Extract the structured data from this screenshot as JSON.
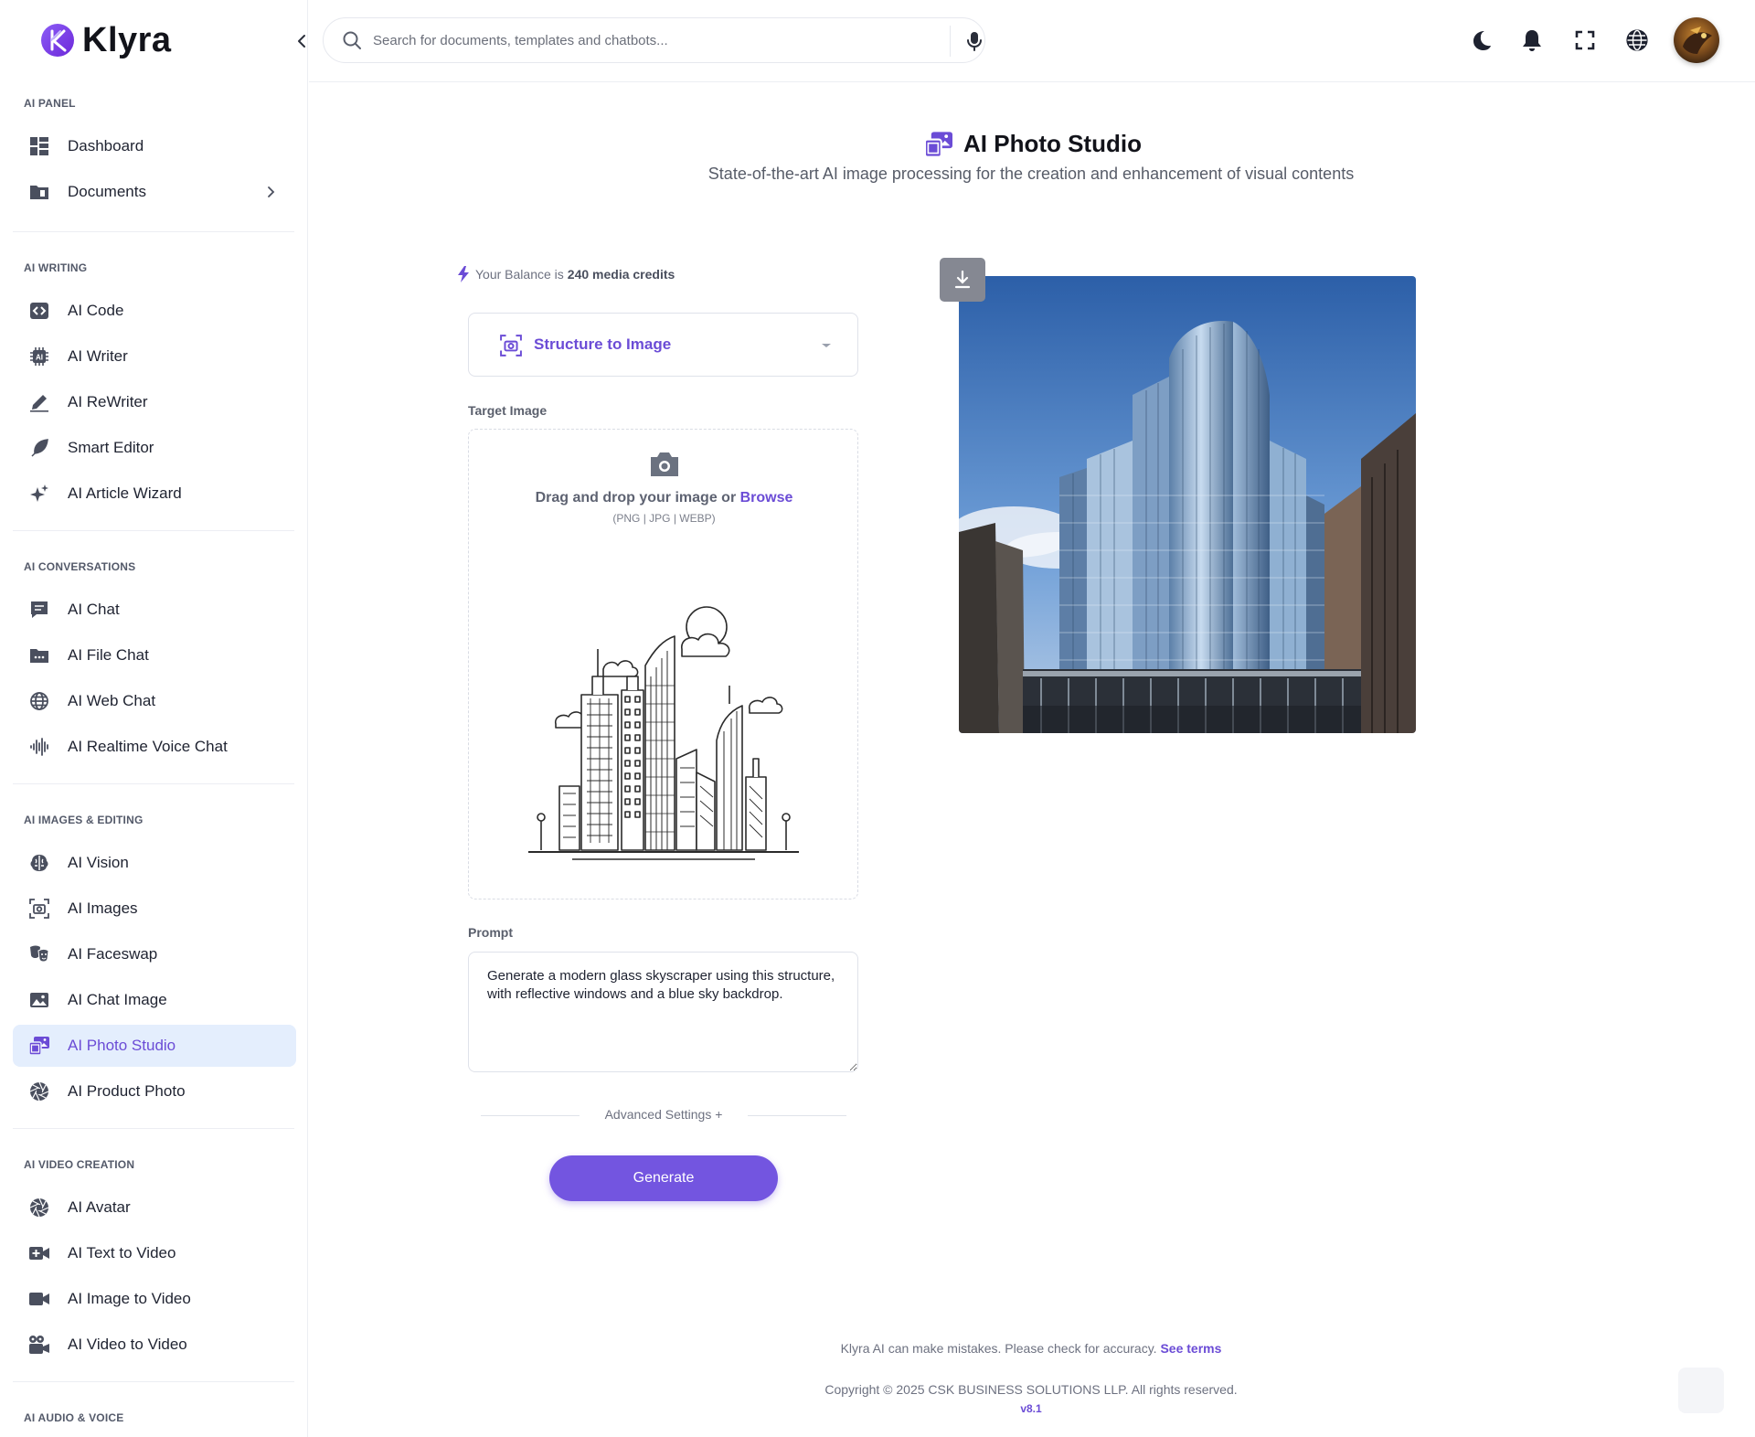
{
  "brand": {
    "name": "Klyra"
  },
  "search": {
    "placeholder": "Search for documents, templates and chatbots..."
  },
  "sidebar": {
    "sections": [
      {
        "title": "AI PANEL",
        "items": [
          {
            "label": "Dashboard",
            "icon": "dashboard-icon"
          },
          {
            "label": "Documents",
            "icon": "folder-icon",
            "has_submenu": true
          }
        ]
      },
      {
        "title": "AI WRITING",
        "items": [
          {
            "label": "AI Code",
            "icon": "code-icon"
          },
          {
            "label": "AI Writer",
            "icon": "chip-icon"
          },
          {
            "label": "AI ReWriter",
            "icon": "pen-icon"
          },
          {
            "label": "Smart Editor",
            "icon": "feather-icon"
          },
          {
            "label": "AI Article Wizard",
            "icon": "sparkles-icon"
          }
        ]
      },
      {
        "title": "AI CONVERSATIONS",
        "items": [
          {
            "label": "AI Chat",
            "icon": "chat-icon"
          },
          {
            "label": "AI File Chat",
            "icon": "file-folder-icon"
          },
          {
            "label": "AI Web Chat",
            "icon": "globe-icon"
          },
          {
            "label": "AI Realtime Voice Chat",
            "icon": "waveform-icon"
          }
        ]
      },
      {
        "title": "AI IMAGES & EDITING",
        "items": [
          {
            "label": "AI Vision",
            "icon": "brain-icon"
          },
          {
            "label": "AI Images",
            "icon": "camera-frame-icon"
          },
          {
            "label": "AI Faceswap",
            "icon": "masks-icon"
          },
          {
            "label": "AI Chat Image",
            "icon": "image-icon"
          },
          {
            "label": "AI Photo Studio",
            "icon": "photo-studio-icon",
            "active": true
          },
          {
            "label": "AI Product Photo",
            "icon": "aperture-icon"
          }
        ]
      },
      {
        "title": "AI VIDEO CREATION",
        "items": [
          {
            "label": "AI Avatar",
            "icon": "aperture-icon"
          },
          {
            "label": "AI Text to Video",
            "icon": "video-plus-icon"
          },
          {
            "label": "AI Image to Video",
            "icon": "video-camera-icon"
          },
          {
            "label": "AI Video to Video",
            "icon": "film-camera-icon"
          }
        ]
      },
      {
        "title": "AI AUDIO & VOICE",
        "items": []
      }
    ]
  },
  "main": {
    "title": "AI Photo Studio",
    "subtitle": "State-of-the-art AI image processing for the creation and enhancement of visual contents",
    "balance": {
      "prefix": "Your Balance is",
      "value": "240 media credits"
    },
    "mode_select": {
      "selected": "Structure to Image"
    },
    "target_image": {
      "label": "Target Image",
      "drop_text": "Drag and drop your image or",
      "browse": "Browse",
      "formats": "(PNG | JPG | WEBP)"
    },
    "prompt": {
      "label": "Prompt",
      "value": "Generate a modern glass skyscraper using this structure, with reflective windows and a blue sky backdrop."
    },
    "advanced_settings": "Advanced Settings +",
    "generate_button": "Generate"
  },
  "footer": {
    "disclaimer": "Klyra AI can make mistakes. Please check for accuracy.",
    "terms_link": "See terms",
    "copyright": "Copyright © 2025 CSK BUSINESS SOLUTIONS LLP. All rights reserved.",
    "version": "v8.1"
  },
  "colors": {
    "accent": "#6b4cd6",
    "active_bg": "#e4eefd",
    "button": "#7355e0"
  }
}
